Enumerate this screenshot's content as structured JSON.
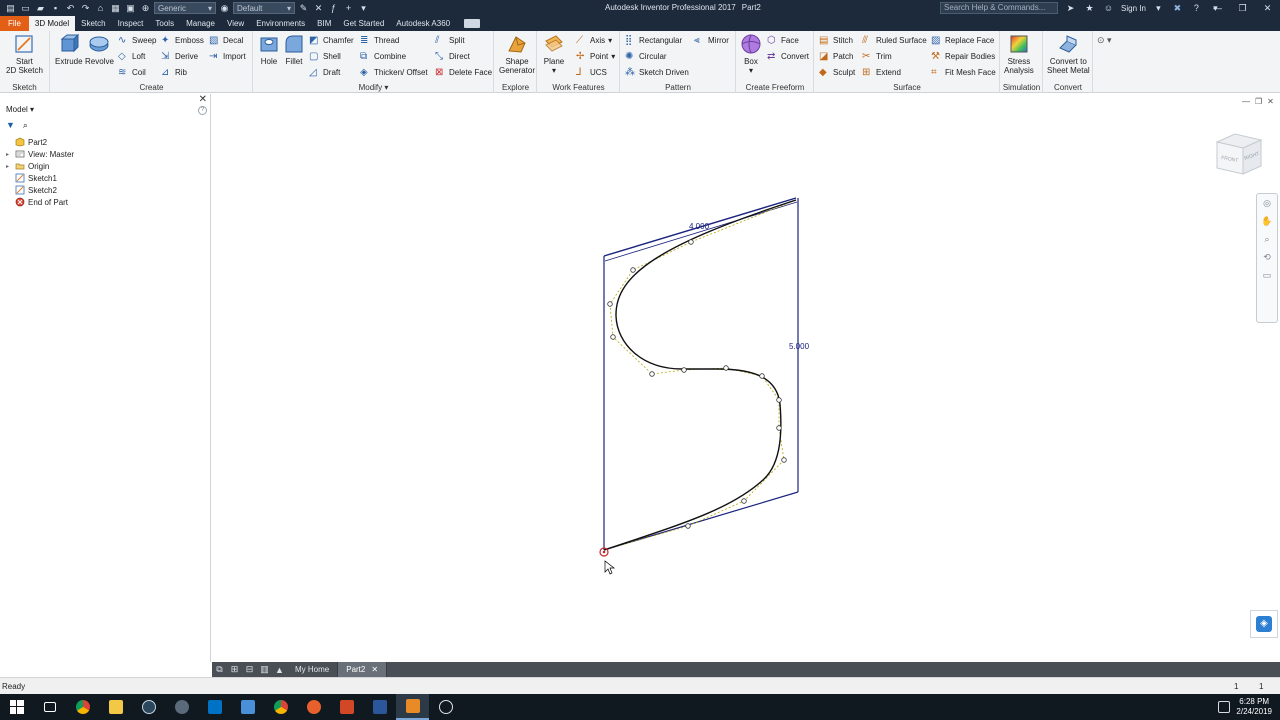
{
  "titlebar": {
    "app_title": "Autodesk Inventor Professional 2017",
    "doc_title": "Part2",
    "material": "Generic",
    "appearance": "Default",
    "search_placeholder": "Search Help & Commands...",
    "sign_in": "Sign In"
  },
  "tabs": [
    "File",
    "3D Model",
    "Sketch",
    "Inspect",
    "Tools",
    "Manage",
    "View",
    "Environments",
    "BIM",
    "Get Started",
    "Autodesk A360"
  ],
  "ribbon": {
    "sketch": {
      "title": "Sketch",
      "start_sketch": "Start",
      "start_sketch_2": "2D Sketch"
    },
    "create": {
      "title": "Create",
      "extrude": "Extrude",
      "revolve": "Revolve",
      "sweep": "Sweep",
      "loft": "Loft",
      "coil": "Coil",
      "emboss": "Emboss",
      "derive": "Derive",
      "rib": "Rib",
      "decal": "Decal",
      "import": "Import"
    },
    "modify": {
      "title": "Modify",
      "hole": "Hole",
      "fillet": "Fillet",
      "chamfer": "Chamfer",
      "shell": "Shell",
      "draft": "Draft",
      "thread": "Thread",
      "combine": "Combine",
      "thicken": "Thicken/ Offset",
      "split": "Split",
      "direct": "Direct",
      "delete_face": "Delete Face"
    },
    "explore": {
      "title": "Explore",
      "shape_gen": "Shape",
      "shape_gen_2": "Generator"
    },
    "work": {
      "title": "Work Features",
      "plane": "Plane",
      "axis": "Axis",
      "point": "Point",
      "ucs": "UCS"
    },
    "pattern": {
      "title": "Pattern",
      "rectangular": "Rectangular",
      "circular": "Circular",
      "sketch_driven": "Sketch Driven",
      "mirror": "Mirror"
    },
    "freeform": {
      "title": "Create Freeform",
      "box": "Box",
      "face": "Face",
      "convert": "Convert"
    },
    "surface": {
      "title": "Surface",
      "stitch": "Stitch",
      "patch": "Patch",
      "sculpt": "Sculpt",
      "ruled": "Ruled Surface",
      "trim": "Trim",
      "extend": "Extend",
      "replace": "Replace Face",
      "repair": "Repair Bodies",
      "fitmesh": "Fit Mesh Face"
    },
    "simulation": {
      "title": "Simulation",
      "stress": "Stress",
      "stress_2": "Analysis"
    },
    "convert": {
      "title": "Convert",
      "sheet": "Convert to",
      "sheet_2": "Sheet Metal"
    }
  },
  "browser": {
    "header": "Model",
    "tree": [
      {
        "label": "Part2",
        "icon": "part-icon"
      },
      {
        "label": "View: Master",
        "icon": "view-icon"
      },
      {
        "label": "Origin",
        "icon": "folder-icon"
      },
      {
        "label": "Sketch1",
        "icon": "sketch-icon"
      },
      {
        "label": "Sketch2",
        "icon": "sketch-icon"
      },
      {
        "label": "End of Part",
        "icon": "end-of-part-icon"
      }
    ]
  },
  "canvas": {
    "dim_top": "4.000",
    "dim_right": "5.000",
    "viewcube_front": "FRONT",
    "viewcube_right": "RIGHT"
  },
  "doctabs": {
    "home": "My Home",
    "part": "Part2"
  },
  "status": {
    "text": "Ready",
    "num1": "1",
    "num2": "1"
  },
  "taskbar": {
    "time": "6:28 PM",
    "date": "2/24/2019"
  }
}
